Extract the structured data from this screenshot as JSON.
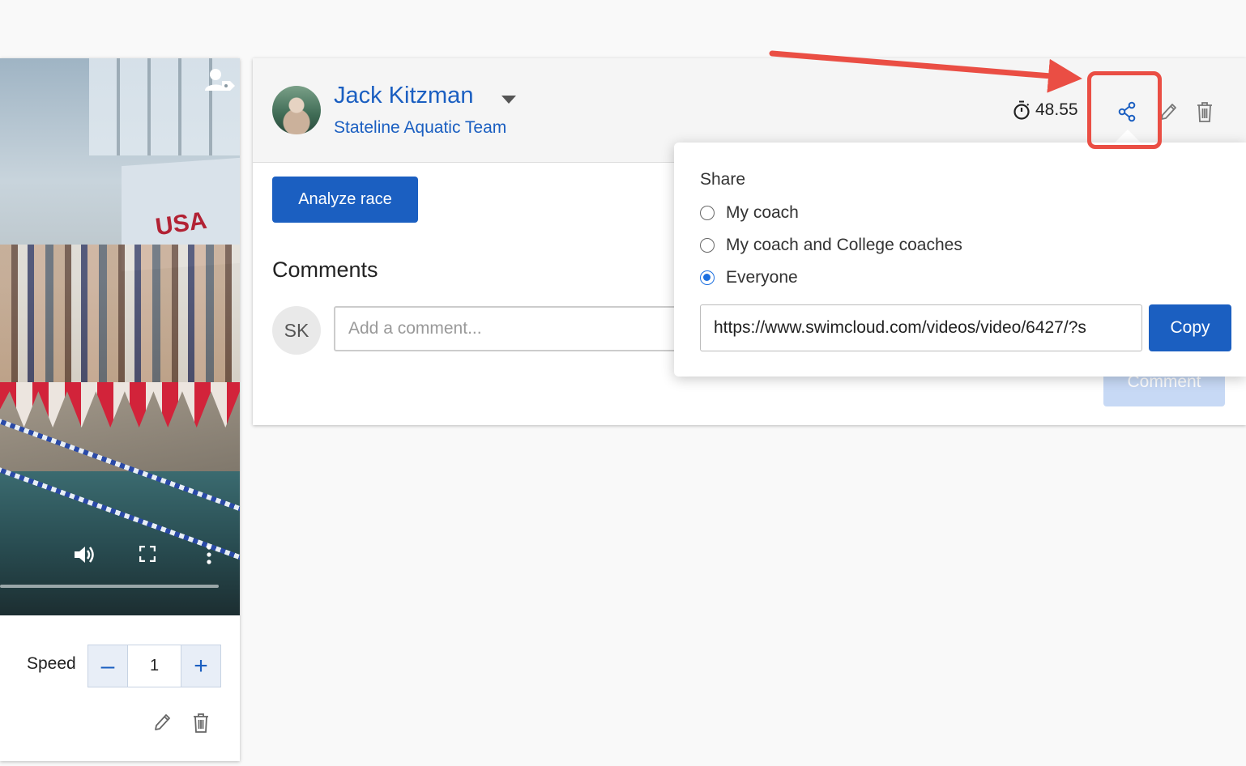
{
  "video": {
    "banner_text": "USA"
  },
  "speed": {
    "label": "Speed",
    "value": "1",
    "minus": "–",
    "plus": "+"
  },
  "race": {
    "athlete_name": "Jack Kitzman",
    "team_name": "Stateline Aquatic Team",
    "time": "48.55",
    "analyze_button": "Analyze race",
    "comments_title": "Comments",
    "user_initials": "SK",
    "comment_placeholder": "Add a comment...",
    "comment_button": "Comment"
  },
  "share": {
    "title": "Share",
    "options": [
      {
        "label": "My coach",
        "selected": false
      },
      {
        "label": "My coach and College coaches",
        "selected": false
      },
      {
        "label": "Everyone",
        "selected": true
      }
    ],
    "url": "https://www.swimcloud.com/videos/video/6427/?s",
    "copy_button": "Copy"
  },
  "colors": {
    "accent": "#1b5fc1",
    "annotation": "#ea4e44",
    "radio_selected": "#1b6fe0"
  },
  "icons": [
    "person-tag-icon",
    "volume-icon",
    "fullscreen-icon",
    "more-vertical-icon",
    "pencil-icon",
    "trash-icon",
    "stopwatch-icon",
    "share-icon",
    "caret-down-icon"
  ]
}
